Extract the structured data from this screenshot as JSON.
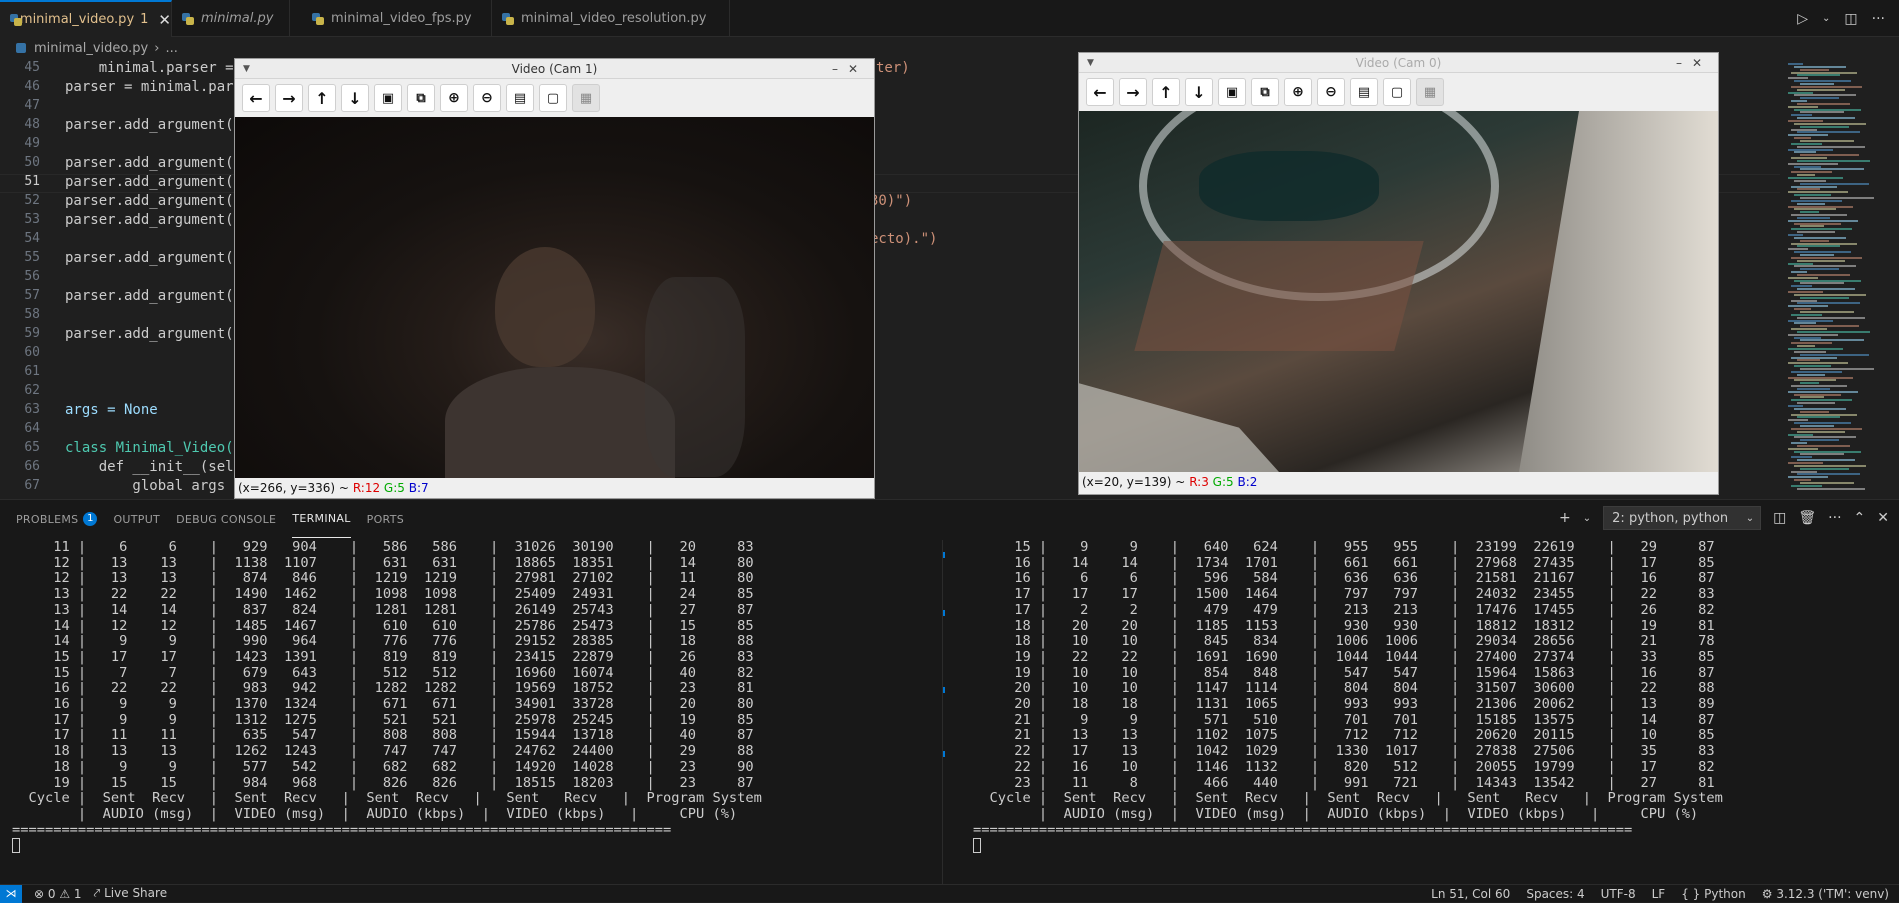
{
  "tabs": [
    {
      "label": "minimal_video.py",
      "modified": "1",
      "active": true
    },
    {
      "label": "minimal.py"
    },
    {
      "label": "minimal_video_fps.py"
    },
    {
      "label": "minimal_video_resolution.py"
    }
  ],
  "breadcrumb": {
    "file": "minimal_video.py",
    "sep": "›",
    "more": "..."
  },
  "editor": {
    "lines": [
      {
        "n": "45",
        "text": "    minimal.parser = "
      },
      {
        "n": "46",
        "text": "parser = minimal.par"
      },
      {
        "n": "47",
        "text": ""
      },
      {
        "n": "48",
        "text": "parser.add_argument("
      },
      {
        "n": "49",
        "text": ""
      },
      {
        "n": "50",
        "text": "parser.add_argument("
      },
      {
        "n": "51",
        "text": "parser.add_argument("
      },
      {
        "n": "52",
        "text": "parser.add_argument("
      },
      {
        "n": "53",
        "text": "parser.add_argument("
      },
      {
        "n": "54",
        "text": ""
      },
      {
        "n": "55",
        "text": "parser.add_argument("
      },
      {
        "n": "56",
        "text": ""
      },
      {
        "n": "57",
        "text": "parser.add_argument("
      },
      {
        "n": "58",
        "text": ""
      },
      {
        "n": "59",
        "text": "parser.add_argument("
      },
      {
        "n": "60",
        "text": ""
      },
      {
        "n": "61",
        "text": ""
      },
      {
        "n": "62",
        "text": ""
      },
      {
        "n": "63",
        "text": "args = None"
      },
      {
        "n": "64",
        "text": ""
      },
      {
        "n": "65",
        "text": "class Minimal_Video("
      },
      {
        "n": "66",
        "text": "    def __init__(sel"
      },
      {
        "n": "67",
        "text": "        global args"
      }
    ],
    "right_fragments": {
      "line45": "ter)",
      "line52": " 30)\")",
      "line54": "ecto).\")"
    }
  },
  "cam1": {
    "title": "Video (Cam 1)",
    "status_coord": "(x=266, y=336) ~",
    "r": "R:12",
    "g": "G:5",
    "b": "B:7"
  },
  "cam0": {
    "title": "Video (Cam 0)",
    "status_coord": "(x=20, y=139) ~",
    "r": "R:3",
    "g": "G:5",
    "b": "B:2"
  },
  "toolbar_icons": [
    "arrow-left-icon",
    "arrow-right-icon",
    "arrow-up-icon",
    "arrow-down-icon",
    "zoom-fit-icon",
    "zoom-original-icon",
    "zoom-in-icon",
    "zoom-out-icon",
    "save-icon",
    "copy-clipboard-icon",
    "properties-icon"
  ],
  "panel": {
    "tabs": [
      {
        "label": "PROBLEMS",
        "badge": "1"
      },
      {
        "label": "OUTPUT"
      },
      {
        "label": "DEBUG CONSOLE"
      },
      {
        "label": "TERMINAL",
        "active": true
      },
      {
        "label": "PORTS"
      }
    ],
    "terminal_select": "2: python, python"
  },
  "terminal_left": {
    "rows": [
      "     11 |    6     6    |   929   904    |   586   586    |  31026  30190    |   20     83",
      "     12 |   13    13    |  1138  1107    |   631   631    |  18865  18351    |   14     80",
      "     12 |   13    13    |   874   846    |  1219  1219    |  27981  27102    |   11     80",
      "     13 |   22    22    |  1490  1462    |  1098  1098    |  25409  24931    |   24     85",
      "     13 |   14    14    |   837   824    |  1281  1281    |  26149  25743    |   27     87",
      "     14 |   12    12    |  1485  1467    |   610   610    |  25786  25473    |   15     85",
      "     14 |    9     9    |   990   964    |   776   776    |  29152  28385    |   18     88",
      "     15 |   17    17    |  1423  1391    |   819   819    |  23415  22879    |   26     83",
      "     15 |    7     7    |   679   643    |   512   512    |  16960  16074    |   40     82",
      "     16 |   22    22    |   983   942    |  1282  1282    |  19569  18752    |   23     81",
      "     16 |    9     9    |  1370  1324    |   671   671    |  34901  33728    |   20     80",
      "     17 |    9     9    |  1312  1275    |   521   521    |  25978  25245    |   19     85",
      "     17 |   11    11    |   635   547    |   808   808    |  15944  13718    |   40     87",
      "     18 |   13    13    |  1262  1243    |   747   747    |  24762  24400    |   29     88",
      "     18 |    9     9    |   577   542    |   682   682    |  14920  14028    |   23     90",
      "     19 |   15    15    |   984   968    |   826   826    |  18515  18203    |   23     87"
    ],
    "header1": "  Cycle |  Sent  Recv   |  Sent  Recv   |  Sent  Recv   |   Sent   Recv   |  Program System",
    "header2": "        |  AUDIO (msg)  |  VIDEO (msg)  |  AUDIO (kbps)  |  VIDEO (kbps)   |     CPU (%)",
    "rule": "================================================================================"
  },
  "terminal_right": {
    "rows": [
      "     15 |    9     9    |   640   624    |   955   955    |  23199  22619    |   29     87",
      "     16 |   14    14    |  1734  1701    |   661   661    |  27968  27435    |   17     85",
      "     16 |    6     6    |   596   584    |   636   636    |  21581  21167    |   16     87",
      "     17 |   17    17    |  1500  1464    |   797   797    |  24032  23455    |   22     83",
      "     17 |    2     2    |   479   479    |   213   213    |  17476  17455    |   26     82",
      "     18 |   20    20    |  1185  1153    |   930   930    |  18812  18312    |   19     81",
      "     18 |   10    10    |   845   834    |  1006  1006    |  29034  28656    |   21     78",
      "     19 |   22    22    |  1691  1690    |  1044  1044    |  27400  27374    |   33     85",
      "     19 |   10    10    |   854   848    |   547   547    |  15964  15863    |   16     87",
      "     20 |   10    10    |  1147  1114    |   804   804    |  31507  30600    |   22     88",
      "     20 |   18    18    |  1131  1065    |   993   993    |  21306  20062    |   13     89",
      "     21 |    9     9    |   571   510    |   701   701    |  15185  13575    |   14     87",
      "     21 |   13    13    |  1102  1075    |   712   712    |  20620  20115    |   10     85",
      "     22 |   17    13    |  1042  1029    |  1330  1017    |  27838  27506    |   35     83",
      "     22 |   16    10    |  1146  1132    |   820   512    |  20055  19799    |   17     82",
      "     23 |   11     8    |   466   440    |   991   721    |  14343  13542    |   27     81"
    ],
    "header1": "  Cycle |  Sent  Recv   |  Sent  Recv   |  Sent  Recv   |   Sent   Recv   |  Program System",
    "header2": "        |  AUDIO (msg)  |  VIDEO (msg)  |  AUDIO (kbps)  |  VIDEO (kbps)   |     CPU (%)",
    "rule": "================================================================================"
  },
  "statusbar": {
    "remote": "⋊",
    "errors": "0",
    "warnings": "1",
    "live_share": "Live Share",
    "position": "Ln 51, Col 60",
    "spaces": "Spaces: 4",
    "encoding": "UTF-8",
    "eol": "LF",
    "language": "Python",
    "interpreter": "3.12.3 ('TM': venv)"
  }
}
